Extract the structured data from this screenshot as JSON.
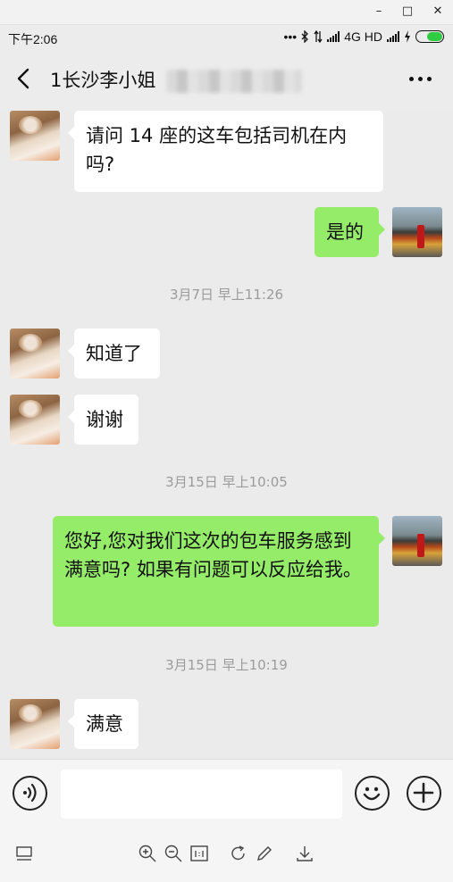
{
  "window": {
    "controls": [
      "–",
      "□",
      "✕"
    ]
  },
  "status_bar": {
    "time": "下午2:06",
    "dots": "•••",
    "network": "4G HD"
  },
  "nav": {
    "title": "1长沙李小姐",
    "back_icon": "back-arrow-icon",
    "more_icon": "more-dots-icon"
  },
  "messages": [
    {
      "side": "left",
      "text": "请问 14 座的这车包括司机在内吗?"
    },
    {
      "side": "right",
      "text": "是的"
    },
    {
      "side": "left",
      "text": "知道了"
    },
    {
      "side": "left",
      "text": "谢谢"
    },
    {
      "side": "right",
      "text": "您好,您对我们这次的包车服务感到满意吗? 如果有问题可以反应给我。"
    },
    {
      "side": "left",
      "text": "满意"
    }
  ],
  "timestamps": [
    "3月7日 早上11:26",
    "3月15日 早上10:05",
    "3月15日 早上10:19"
  ],
  "input": {
    "value": "",
    "placeholder": ""
  },
  "colors": {
    "sent_bubble": "#95ec69",
    "received_bubble": "#ffffff",
    "background": "#ebebeb"
  }
}
